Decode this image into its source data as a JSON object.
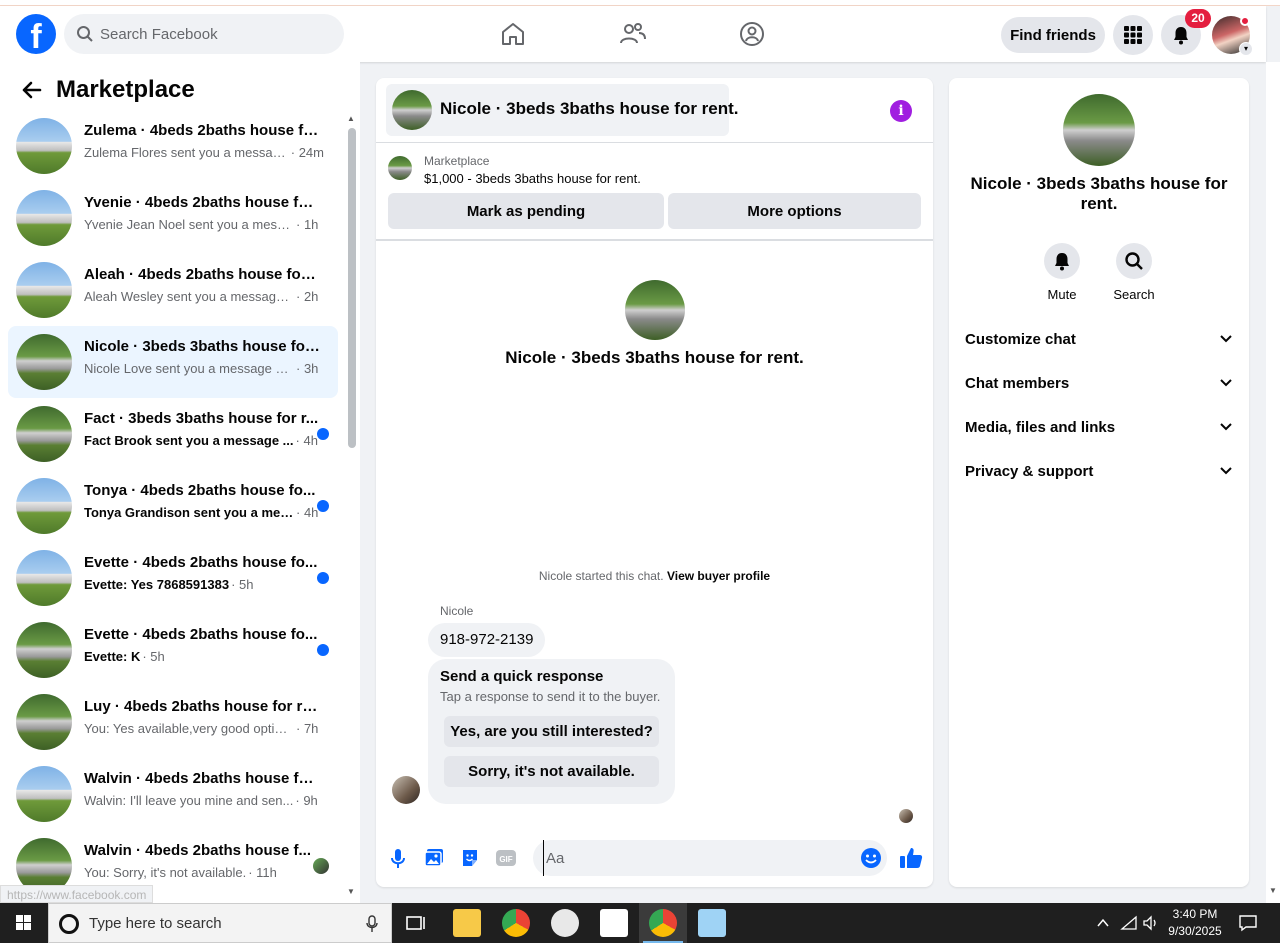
{
  "header": {
    "search_placeholder": "Search Facebook",
    "find_friends_label": "Find friends",
    "notification_count": "20"
  },
  "sidebar": {
    "title": "Marketplace",
    "conversations": [
      {
        "title": "Zulema · 4beds 2baths house fo...",
        "message": "Zulema Flores sent you a messag...",
        "time": "· 24m",
        "unread": false,
        "active": false,
        "thumb": "house"
      },
      {
        "title": "Yvenie · 4beds 2baths house for ...",
        "message": "Yvenie Jean Noel sent you a messa...",
        "time": "· 1h",
        "unread": false,
        "active": false,
        "thumb": "house"
      },
      {
        "title": "Aleah · 4beds 2baths house for r...",
        "message": "Aleah Wesley sent you a message a...",
        "time": "· 2h",
        "unread": false,
        "active": false,
        "thumb": "house"
      },
      {
        "title": "Nicole · 3beds 3baths house for ...",
        "message": "Nicole Love sent you a message ab...",
        "time": "· 3h",
        "unread": false,
        "active": true,
        "thumb": "tree"
      },
      {
        "title": "Fact · 3beds 3baths house for r...",
        "message": "Fact Brook sent you a message ...",
        "time": "· 4h",
        "unread": true,
        "active": false,
        "thumb": "tree"
      },
      {
        "title": "Tonya · 4beds 2baths house fo...",
        "message": "Tonya Grandison sent you a mes...",
        "time": "· 4h",
        "unread": true,
        "active": false,
        "thumb": "house"
      },
      {
        "title": "Evette · 4beds 2baths house fo...",
        "message": "Evette: Yes 7868591383",
        "time": "· 5h",
        "unread": true,
        "active": false,
        "thumb": "house"
      },
      {
        "title": "Evette · 4beds 2baths house fo...",
        "message": "Evette: K",
        "time": "· 5h",
        "unread": true,
        "active": false,
        "thumb": "tree"
      },
      {
        "title": "Luy · 4beds 2baths house for rent.",
        "message": "You: Yes available,very good option...",
        "time": "· 7h",
        "unread": false,
        "active": false,
        "thumb": "tree"
      },
      {
        "title": "Walvin · 4beds 2baths house for...",
        "message": "Walvin: I'll leave you mine and sen...",
        "time": "· 9h",
        "unread": false,
        "active": false,
        "thumb": "house"
      },
      {
        "title": "Walvin · 4beds 2baths house f...",
        "message": "You: Sorry, it's not available.",
        "time": "· 11h",
        "unread": false,
        "active": false,
        "thumb": "tree"
      }
    ],
    "status_url": "https://www.facebook.com"
  },
  "chat": {
    "title": "Nicole · 3beds 3baths house for rent.",
    "listing_source": "Marketplace",
    "listing_price": "$1,000 - 3beds 3baths house for rent.",
    "mark_pending_label": "Mark as pending",
    "more_options_label": "More options",
    "hero_title": "Nicole · 3beds 3baths house for rent.",
    "started_text": "Nicole started this chat.",
    "buyer_profile_link": "View buyer profile",
    "sender_name": "Nicole",
    "phone_message": "918-972-2139",
    "quick_title": "Send a quick response",
    "quick_subtitle": "Tap a response to send it to the buyer.",
    "quick_option_1": "Yes, are you still interested?",
    "quick_option_2": "Sorry, it's not available.",
    "composer_placeholder": "Aa"
  },
  "info_panel": {
    "title": "Nicole · 3beds 3baths house for rent.",
    "mute_label": "Mute",
    "search_label": "Search",
    "sections": [
      "Customize chat",
      "Chat members",
      "Media, files and links",
      "Privacy & support"
    ]
  },
  "taskbar": {
    "search_placeholder": "Type here to search",
    "time": "3:40 PM",
    "date": "9/30/2025"
  },
  "colors": {
    "brand_blue": "#0866ff",
    "active_row": "#ebf5ff",
    "info_purple": "#a01ee0",
    "badge_red": "#e41e3f"
  }
}
